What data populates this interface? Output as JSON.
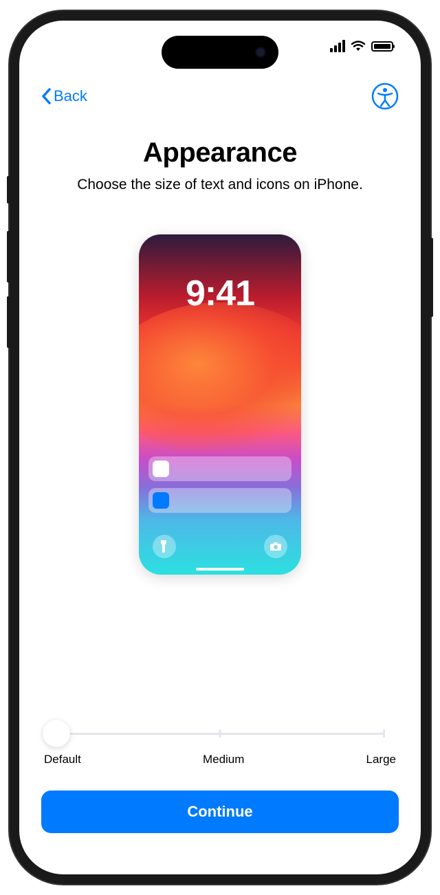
{
  "nav": {
    "back_label": "Back"
  },
  "header": {
    "title": "Appearance",
    "subtitle": "Choose the size of text and icons on iPhone."
  },
  "preview": {
    "time": "9:41"
  },
  "slider": {
    "labels": {
      "default": "Default",
      "medium": "Medium",
      "large": "Large"
    },
    "selected": "Default"
  },
  "actions": {
    "continue_label": "Continue"
  }
}
